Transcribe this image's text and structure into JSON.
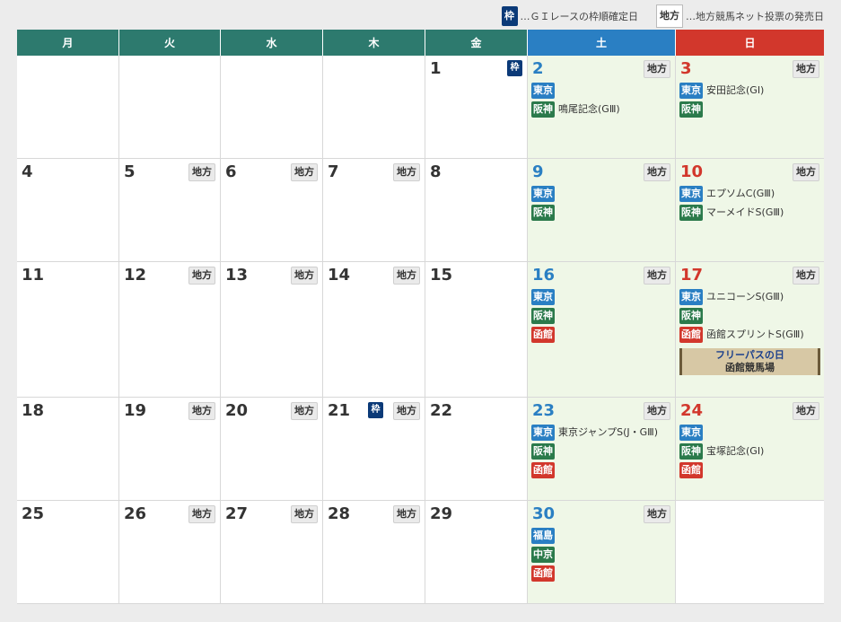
{
  "legend": {
    "waku_icon": "枠",
    "waku_text": "…ＧＩレースの枠順確定日",
    "chiho_icon": "地方",
    "chiho_text": "…地方競馬ネット投票の発売日"
  },
  "weekdays": [
    "月",
    "火",
    "水",
    "木",
    "金",
    "土",
    "日"
  ],
  "chiho_label": "地方",
  "waku_label": "枠",
  "colors": {
    "weekday_header": "#2d7a6e",
    "sat": "#2a7fc3",
    "sun": "#d2372c",
    "weekend_bg": "#eff7e7",
    "waku": "#0b3a78"
  },
  "rows": [
    [
      {
        "day": ""
      },
      {
        "day": ""
      },
      {
        "day": ""
      },
      {
        "day": ""
      },
      {
        "day": "1",
        "waku": true
      },
      {
        "day": "2",
        "chiho": true,
        "races": [
          {
            "venue": "東京",
            "color": "blue",
            "name": ""
          },
          {
            "venue": "阪神",
            "color": "green",
            "name": "鳴尾記念(GⅢ)"
          }
        ]
      },
      {
        "day": "3",
        "chiho": true,
        "races": [
          {
            "venue": "東京",
            "color": "blue",
            "name": "安田記念(GⅠ)"
          },
          {
            "venue": "阪神",
            "color": "green",
            "name": ""
          }
        ]
      }
    ],
    [
      {
        "day": "4"
      },
      {
        "day": "5",
        "chiho": true
      },
      {
        "day": "6",
        "chiho": true
      },
      {
        "day": "7",
        "chiho": true
      },
      {
        "day": "8"
      },
      {
        "day": "9",
        "chiho": true,
        "races": [
          {
            "venue": "東京",
            "color": "blue",
            "name": ""
          },
          {
            "venue": "阪神",
            "color": "green",
            "name": ""
          }
        ]
      },
      {
        "day": "10",
        "chiho": true,
        "races": [
          {
            "venue": "東京",
            "color": "blue",
            "name": "エプソムC(GⅢ)"
          },
          {
            "venue": "阪神",
            "color": "green",
            "name": "マーメイドS(GⅢ)"
          }
        ]
      }
    ],
    [
      {
        "day": "11"
      },
      {
        "day": "12",
        "chiho": true
      },
      {
        "day": "13",
        "chiho": true
      },
      {
        "day": "14",
        "chiho": true
      },
      {
        "day": "15"
      },
      {
        "day": "16",
        "chiho": true,
        "races": [
          {
            "venue": "東京",
            "color": "blue",
            "name": ""
          },
          {
            "venue": "阪神",
            "color": "green",
            "name": ""
          },
          {
            "venue": "函館",
            "color": "red",
            "name": ""
          }
        ]
      },
      {
        "day": "17",
        "chiho": true,
        "races": [
          {
            "venue": "東京",
            "color": "blue",
            "name": "ユニコーンS(GⅢ)"
          },
          {
            "venue": "阪神",
            "color": "green",
            "name": ""
          },
          {
            "venue": "函館",
            "color": "red",
            "name": "函館スプリントS(GⅢ)"
          }
        ],
        "freepass": {
          "line1": "フリーパスの日",
          "line2": "函館競馬場"
        }
      }
    ],
    [
      {
        "day": "18"
      },
      {
        "day": "19",
        "chiho": true
      },
      {
        "day": "20",
        "chiho": true
      },
      {
        "day": "21",
        "chiho": true,
        "waku": true
      },
      {
        "day": "22"
      },
      {
        "day": "23",
        "chiho": true,
        "races": [
          {
            "venue": "東京",
            "color": "blue",
            "name": "東京ジャンプS(J・GⅢ)"
          },
          {
            "venue": "阪神",
            "color": "green",
            "name": ""
          },
          {
            "venue": "函館",
            "color": "red",
            "name": ""
          }
        ]
      },
      {
        "day": "24",
        "chiho": true,
        "races": [
          {
            "venue": "東京",
            "color": "blue",
            "name": ""
          },
          {
            "venue": "阪神",
            "color": "green",
            "name": "宝塚記念(GⅠ)"
          },
          {
            "venue": "函館",
            "color": "red",
            "name": ""
          }
        ]
      }
    ],
    [
      {
        "day": "25"
      },
      {
        "day": "26",
        "chiho": true
      },
      {
        "day": "27",
        "chiho": true
      },
      {
        "day": "28",
        "chiho": true
      },
      {
        "day": "29"
      },
      {
        "day": "30",
        "chiho": true,
        "races": [
          {
            "venue": "福島",
            "color": "blue",
            "name": ""
          },
          {
            "venue": "中京",
            "color": "green",
            "name": ""
          },
          {
            "venue": "函館",
            "color": "red",
            "name": ""
          }
        ]
      },
      {
        "day": ""
      }
    ]
  ]
}
